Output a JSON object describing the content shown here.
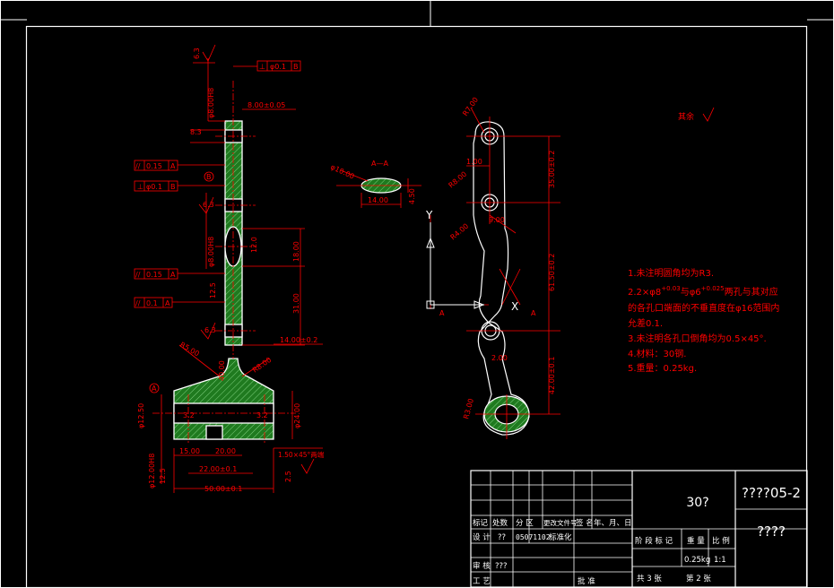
{
  "colors": {
    "background": "#000000",
    "frame": "#ffffff",
    "dimension": "#ff0000",
    "outline": "#ffffff",
    "hatch": "#1f7a1f",
    "hatch_line": "#7fd07f"
  },
  "left_view": {
    "roughness_top": "6.3",
    "tol_parallel_top": {
      "sym": "⊥",
      "value": "φ0.1",
      "datum": "B"
    },
    "hole_dim_top": "φ8.00H8",
    "width_dim": "8.00±0.05",
    "dim_83": "8.3",
    "tol_rows": [
      {
        "sym": "//",
        "value": "0.15",
        "datum": "A"
      },
      {
        "sym": "⊥",
        "value": "φ0.1",
        "datum": "B"
      },
      {
        "sym": "//",
        "value": "0.15",
        "datum": "A"
      },
      {
        "sym": "//",
        "value": "0.1",
        "datum": "A"
      }
    ],
    "datum_b": "B",
    "dim_63b": "6.3",
    "hole_dim_mid": "φ8.00H8",
    "r_12": "12.0",
    "dim_18": "18.00",
    "dim_31": "31.00",
    "dim_125": "12.5",
    "dim_63c": "6.3",
    "dim_14": "14.00±0.2",
    "r_5": "R5.00",
    "r_8": "R8.00",
    "dim_40": "40.00",
    "datum_a": "A",
    "dim_1250": "φ12.50",
    "dim_32": "3.2",
    "dim_24": "φ24.00",
    "dim_15": "15.00",
    "dim_20": "20.00",
    "chamfer": "1.50×45°两端",
    "dim_hole_bot": "φ12.00H8",
    "dim_125b": "12.5",
    "dim_22": "22.00±0.1",
    "dim_25": "2.5",
    "dim_50": "50.00±0.1"
  },
  "section_view": {
    "label": "A—A",
    "dim_diam": "φ10.00",
    "dim_width": "14.00",
    "dim_depth": "4.50"
  },
  "right_view": {
    "r_7": "R7.00",
    "r_8": "R8.00",
    "r_4": "R4.00",
    "dim_100": "1.00",
    "dim_35": "35.00±0.2",
    "dim_6150": "61.50±0.2",
    "dim_42": "42.00±0.1",
    "dim_9": "9.00",
    "dim_2": "2.00",
    "dim_r": "R3.00",
    "axis_y": "Y",
    "axis_x": "X",
    "a_label": "A",
    "a_label2": "A"
  },
  "roughness_rest": "其余",
  "notes": [
    "1.未注明圆角均为R3.",
    "2.2×φ8",
    "的各孔口端面的不垂直度在φ16范围内",
    "允差0.1.",
    "3.未注明各孔口倒角均为0.5×45°.",
    "4.材料：30钢.",
    "5.重量：0.25kg."
  ],
  "note2_parts": {
    "sup1": "+0.03",
    "mid": "与φ6",
    "sup2": "+0.025",
    "end": "两孔与其对应"
  },
  "title_block": {
    "title_center": "30?",
    "drawing_no": "????05-2",
    "drawing_name": "????",
    "hdr_cells": [
      "标记",
      "处数",
      "分 区",
      "更改文件号",
      "签 名",
      "年、月、日"
    ],
    "design_label": "设 计",
    "design_name": "??",
    "design_date": "05071102",
    "std_label": "标准化",
    "review_label": "审 核",
    "review_name": "???",
    "craft_label": "工 艺",
    "approve_label": "批 准",
    "stage_cells": [
      "阶 段 标 记",
      "重 量",
      "比 例"
    ],
    "weight": "0.25kg",
    "scale": "1:1",
    "sheets": "共 3 张",
    "sheet_no": "第 2 张"
  }
}
